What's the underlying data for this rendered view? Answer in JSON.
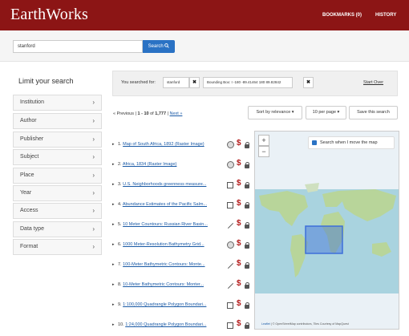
{
  "navbar": {
    "brand": "EarthWorks",
    "bookmarks": "BOOKMARKS (0)",
    "history": "HISTORY",
    "color": "#8c1515"
  },
  "search": {
    "value": "stanford",
    "button_label": "Search",
    "button_icon": "search-icon"
  },
  "sidebar": {
    "title": "Limit your search",
    "facets": [
      {
        "label": "Institution"
      },
      {
        "label": "Author"
      },
      {
        "label": "Publisher"
      },
      {
        "label": "Subject"
      },
      {
        "label": "Place"
      },
      {
        "label": "Year"
      },
      {
        "label": "Access"
      },
      {
        "label": "Data type"
      },
      {
        "label": "Format"
      }
    ]
  },
  "constraints": {
    "label": "You searched for:",
    "chips": [
      {
        "text": "stanford",
        "remove": "✖"
      },
      {
        "text": "Bounding Box: Ι -180 -89.41464 180 89.82842",
        "remove": "✖"
      }
    ],
    "start_over": "Start Over"
  },
  "toolbar": {
    "previous": "« Previous",
    "range_prefix": "1 - 10",
    "range_of": "of",
    "total": "1,777",
    "next": "Next »",
    "sort": "Sort by relevance ▾",
    "per_page": "10 per page ▾",
    "save": "Save this search"
  },
  "results": [
    {
      "number": "1.",
      "title": "Map of South Africa, 1892 (Raster Image)",
      "icons": [
        "globe-icon",
        "paid-icon",
        "unlock-icon"
      ]
    },
    {
      "number": "2.",
      "title": "Africa, 1834 (Raster Image)",
      "icons": [
        "globe-icon",
        "paid-icon",
        "unlock-icon"
      ]
    },
    {
      "number": "3.",
      "title": "U.S. Neighborhoods greenness measure...",
      "icons": [
        "polygon-icon",
        "paid-icon",
        "unlock-icon"
      ]
    },
    {
      "number": "4.",
      "title": "Abundance Estimates of the Pacific Salm...",
      "icons": [
        "polygon-icon",
        "paid-icon",
        "unlock-icon"
      ]
    },
    {
      "number": "5.",
      "title": "10 Meter Countours: Russian River Basin...",
      "icons": [
        "line-icon",
        "paid-icon",
        "lock-icon"
      ]
    },
    {
      "number": "6.",
      "title": "1000 Meter-Resolution Bathymetry Grid...",
      "icons": [
        "globe-icon",
        "paid-icon",
        "lock-icon"
      ]
    },
    {
      "number": "7.",
      "title": "100-Meter Bathymetric Contours: Monte...",
      "icons": [
        "line-icon",
        "paid-icon",
        "lock-icon"
      ]
    },
    {
      "number": "8.",
      "title": "10-Meter Bathymetric Contours: Monter...",
      "icons": [
        "line-icon",
        "paid-icon",
        "lock-icon"
      ]
    },
    {
      "number": "9.",
      "title": "1:100,000 Quadrangle Polygon Boundari...",
      "icons": [
        "polygon-icon",
        "paid-icon",
        "lock-icon"
      ]
    },
    {
      "number": "10.",
      "title": "1:24,000 Quadrangle Polygon Boundari...",
      "icons": [
        "polygon-icon",
        "paid-icon",
        "lock-icon"
      ]
    }
  ],
  "map": {
    "zoom_in": "+",
    "zoom_out": "−",
    "checkbox_label": "Search when I move the map",
    "checkbox_checked": true,
    "attribution_leaflet": "Leaflet",
    "attribution_text": "| © OpenStreetMap contributors, Tiles Courtesy of MapQuest",
    "ocean_color": "#a9d3df",
    "land_color": "#b8d59a",
    "bbox_color": "#3d6fd9"
  }
}
